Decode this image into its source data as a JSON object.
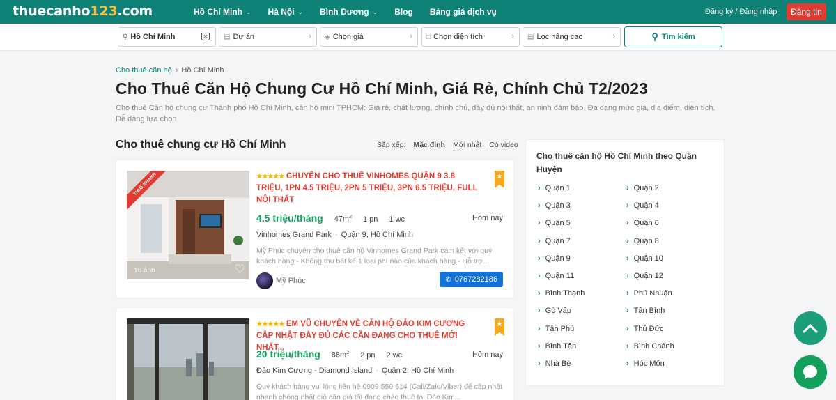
{
  "header": {
    "logo_text": "thuecanho",
    "logo_num": "123",
    "logo_tld": ".com",
    "nav": [
      {
        "label": "Hồ Chí Minh",
        "has_dropdown": true
      },
      {
        "label": "Hà Nội",
        "has_dropdown": true
      },
      {
        "label": "Bình Dương",
        "has_dropdown": true
      },
      {
        "label": "Blog",
        "has_dropdown": false
      },
      {
        "label": "Bảng giá dịch vụ",
        "has_dropdown": false
      }
    ],
    "auth_link": "Đăng ký / Đăng nhập",
    "post_button": "Đăng tin",
    "colors": {
      "primary": "#0e8276",
      "accent_red": "#e03c31",
      "logo_highlight": "#f6c042"
    }
  },
  "filters": {
    "location": "Hồ Chí Minh",
    "project": "Dự án",
    "price": "Chọn giá",
    "area": "Chọn diện tích",
    "advanced": "Lọc nâng cao",
    "search_button": "Tìm kiếm"
  },
  "breadcrumb": {
    "root": "Cho thuê căn hộ",
    "current": "Hồ Chí Minh"
  },
  "page": {
    "title": "Cho Thuê Căn Hộ Chung Cư Hồ Chí Minh, Giá Rẻ, Chính Chủ T2/2023",
    "description": "Cho thuê Căn hộ chung cư Thành phố Hồ Chí Minh, căn hộ mini TPHCM: Giá rẻ, chất lượng, chính chủ, đầy đủ nội thất, an ninh đảm bảo. Đa dạng mức giá, địa điểm, diện tích. Dễ dàng lựa chọn",
    "section_title": "Cho thuê chung cư Hồ Chí Minh"
  },
  "sort": {
    "label": "Sắp xếp:",
    "options": [
      "Mặc định",
      "Mới nhất",
      "Có video"
    ],
    "active": "Mặc định"
  },
  "listings": [
    {
      "badge": "THUÊ NHANH",
      "stars": "★★★★★",
      "title": "CHUYÊN CHO THUÊ VINHOMES QUẬN 9 3.8 TRIỆU, 1PN 4.5 TRIỆU, 2PN 5 TRIỆU, 3PN 6.5 TRIỆU, FULL NỘI THẤT",
      "price": "4.5 triệu/tháng",
      "area": "47m",
      "beds": "1 pn",
      "baths": "1 wc",
      "posted": "Hôm nay",
      "project": "Vinhomes Grand Park",
      "location": "Quận 9, Hồ Chí Minh",
      "snippet": "Mỹ Phúc chuyên cho thuê căn hộ Vinhomes Grand Park cam kết với quý khách hàng:- Không thu bất kể 1 loại phí nào của khách hàng.- Hỗ trợ...",
      "image_count": "16 ảnh",
      "owner": "Mỹ Phúc",
      "phone": "0767282186"
    },
    {
      "stars": "★★★★★",
      "title": "EM VŨ CHUYÊN VỀ CĂN HỘ ĐẢO KIM CƯƠNG CẬP NHẬT ĐẦY ĐỦ CÁC CĂN ĐANG CHO THUÊ MỚI NHẤT...",
      "price": "20 triệu/tháng",
      "area": "88m",
      "beds": "2 pn",
      "baths": "2 wc",
      "posted": "Hôm nay",
      "project": "Đảo Kim Cương - Diamond Island",
      "location": "Quận 2, Hồ Chí Minh",
      "snippet": "Quý khách hàng vui lòng liên hệ 0909 550 614 (Call/Zalo/Viber) để cập nhật nhanh chóng nhất giỏ căn giá tốt đang chào thuê tại Đảo Kim..."
    }
  ],
  "sidebar": {
    "title": "Cho thuê căn hộ Hồ Chí Minh theo Quận Huyện",
    "districts": [
      "Quận 1",
      "Quận 2",
      "Quận 3",
      "Quận 4",
      "Quận 5",
      "Quận 6",
      "Quận 7",
      "Quận 8",
      "Quận 9",
      "Quận 10",
      "Quận 11",
      "Quận 12",
      "Bình Thạnh",
      "Phú Nhuận",
      "Gò Vấp",
      "Tân Bình",
      "Tân Phú",
      "Thủ Đức",
      "Bình Tân",
      "Bình Chánh",
      "Nhà Bè",
      "Hóc Môn"
    ]
  }
}
